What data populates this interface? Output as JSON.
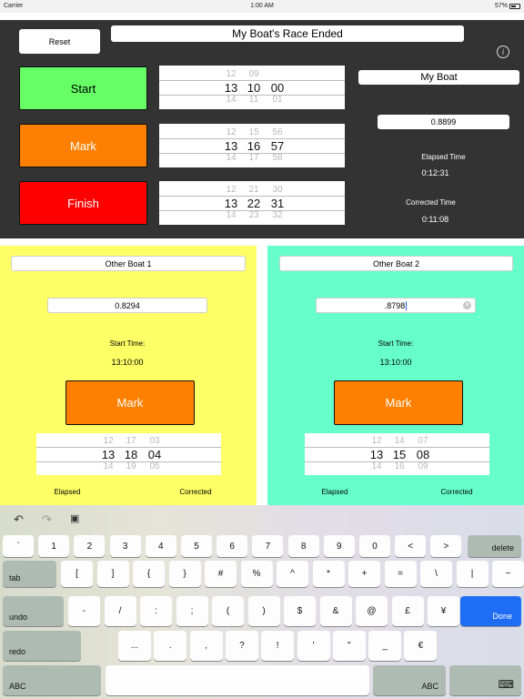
{
  "status": {
    "carrier": "Carrier",
    "time": "1:00 AM",
    "battery": "57%"
  },
  "top": {
    "reset_label": "Reset",
    "title": "My Boat's Race Ended",
    "info_glyph": "i",
    "start_label": "Start",
    "mark_label": "Mark",
    "finish_label": "Finish",
    "boat_name": "My Boat",
    "rating": "0.8899",
    "elapsed_label": "Elapsed Time",
    "elapsed_value": "0:12:31",
    "corrected_label": "Corrected Time",
    "corrected_value": "0:11:08",
    "colors": {
      "start": "#66ff66",
      "mark": "#ff8000",
      "finish": "#ff0000",
      "background": "#333333"
    },
    "pickers": [
      {
        "above": [
          "12",
          "09",
          ""
        ],
        "selected": [
          "13",
          "10",
          "00"
        ],
        "below": [
          "14",
          "11",
          "01"
        ]
      },
      {
        "above": [
          "12",
          "15",
          "56"
        ],
        "selected": [
          "13",
          "16",
          "57"
        ],
        "below": [
          "14",
          "17",
          "58"
        ]
      },
      {
        "above": [
          "12",
          "21",
          "30"
        ],
        "selected": [
          "13",
          "22",
          "31"
        ],
        "below": [
          "14",
          "23",
          "32"
        ]
      }
    ]
  },
  "boats": [
    {
      "name": "Other Boat 1",
      "rating": "0.8294",
      "start_label": "Start Time:",
      "start_time": "13:10:00",
      "mark_label": "Mark",
      "picker": {
        "above": [
          "12",
          "17",
          "03"
        ],
        "selected": [
          "13",
          "18",
          "04"
        ],
        "below": [
          "14",
          "19",
          "05"
        ]
      },
      "elapsed_label": "Elapsed",
      "corrected_label": "Corrected",
      "color": "#ffff66"
    },
    {
      "name": "Other Boat 2",
      "rating": ".8798",
      "start_label": "Start Time:",
      "start_time": "13:10:00",
      "mark_label": "Mark",
      "picker": {
        "above": [
          "12",
          "14",
          "07"
        ],
        "selected": [
          "13",
          "15",
          "08"
        ],
        "below": [
          "14",
          "16",
          "09"
        ]
      },
      "elapsed_label": "Elapsed",
      "corrected_label": "Corrected",
      "color": "#66ffcc"
    }
  ],
  "keyboard": {
    "row1": [
      "`",
      "1",
      "2",
      "3",
      "4",
      "5",
      "6",
      "7",
      "8",
      "9",
      "0",
      "<",
      ">"
    ],
    "delete": "delete",
    "tab": "tab",
    "row2": [
      "[",
      "]",
      "{",
      "}",
      "#",
      "%",
      "^",
      "*",
      "+",
      "=",
      "\\",
      "|",
      "~"
    ],
    "undo": "undo",
    "row3": [
      "-",
      "/",
      ":",
      ";",
      "(",
      ")",
      "$",
      "&",
      "@",
      "£",
      "¥"
    ],
    "done": "Done",
    "redo": "redo",
    "row4": [
      "...",
      ".",
      ",",
      "?",
      "!",
      "'",
      "\"",
      "_",
      "€"
    ],
    "abc": "ABC"
  }
}
